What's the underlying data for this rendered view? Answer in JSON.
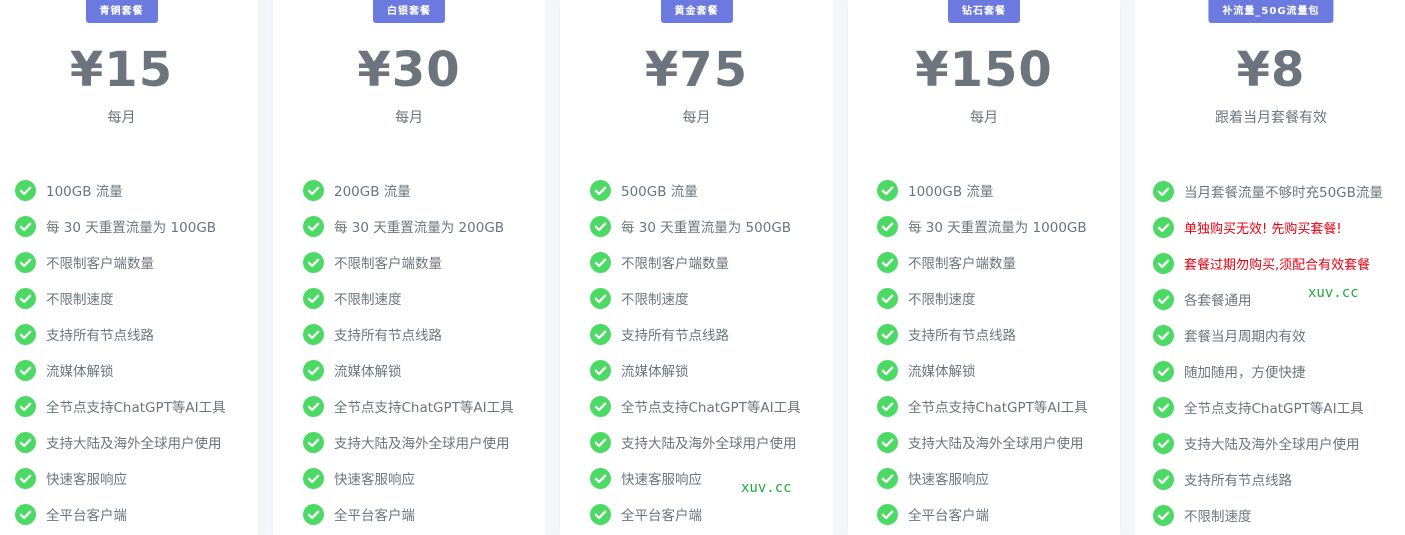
{
  "colors": {
    "badge": "#6c7ae0",
    "check": "#4cd964",
    "text": "#6c757d",
    "warn": "#e60012",
    "watermark": "#1faa3c"
  },
  "plans": [
    {
      "name": "青铜套餐",
      "price": "¥15",
      "period": "每月",
      "features": [
        "100GB 流量",
        "每 30 天重置流量为 100GB",
        "不限制客户端数量",
        "不限制速度",
        "支持所有节点线路",
        "流媒体解锁",
        "全节点支持ChatGPT等AI工具",
        "支持大陆及海外全球用户使用",
        "快速客服响应",
        "全平台客户端"
      ]
    },
    {
      "name": "白银套餐",
      "price": "¥30",
      "period": "每月",
      "features": [
        "200GB 流量",
        "每 30 天重置流量为 200GB",
        "不限制客户端数量",
        "不限制速度",
        "支持所有节点线路",
        "流媒体解锁",
        "全节点支持ChatGPT等AI工具",
        "支持大陆及海外全球用户使用",
        "快速客服响应",
        "全平台客户端"
      ]
    },
    {
      "name": "黄金套餐",
      "price": "¥75",
      "period": "每月",
      "features": [
        "500GB 流量",
        "每 30 天重置流量为 500GB",
        "不限制客户端数量",
        "不限制速度",
        "支持所有节点线路",
        "流媒体解锁",
        "全节点支持ChatGPT等AI工具",
        "支持大陆及海外全球用户使用",
        "快速客服响应",
        "全平台客户端"
      ]
    },
    {
      "name": "钻石套餐",
      "price": "¥150",
      "period": "每月",
      "features": [
        "1000GB 流量",
        "每 30 天重置流量为 1000GB",
        "不限制客户端数量",
        "不限制速度",
        "支持所有节点线路",
        "流媒体解锁",
        "全节点支持ChatGPT等AI工具",
        "支持大陆及海外全球用户使用",
        "快速客服响应",
        "全平台客户端"
      ]
    },
    {
      "name": "补流量_50G流量包",
      "price": "¥8",
      "period": "跟着当月套餐有效",
      "features": [
        "当月套餐流量不够时充50GB流量",
        "单独购买无效! 先购买套餐!",
        "套餐过期勿购买,须配合有效套餐",
        "各套餐通用",
        "套餐当月周期内有效",
        "随加随用，方便快捷",
        "全节点支持ChatGPT等AI工具",
        "支持大陆及海外全球用户使用",
        "支持所有节点线路",
        "不限制速度"
      ]
    }
  ],
  "watermarks": [
    "xuv.cc",
    "xuv.cc"
  ]
}
